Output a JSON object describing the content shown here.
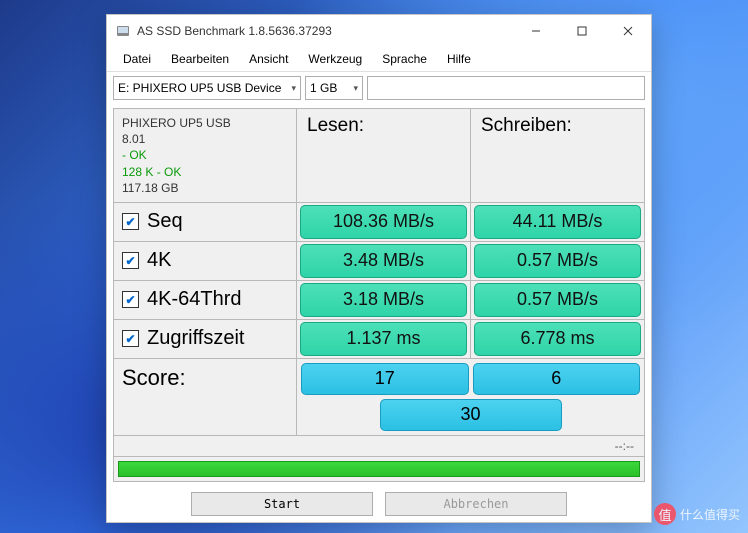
{
  "window": {
    "title": "AS SSD Benchmark 1.8.5636.37293"
  },
  "menu": {
    "datei": "Datei",
    "bearbeiten": "Bearbeiten",
    "ansicht": "Ansicht",
    "werkzeug": "Werkzeug",
    "sprache": "Sprache",
    "hilfe": "Hilfe"
  },
  "toolbar": {
    "drive": "E: PHIXERO UP5 USB Device",
    "size": "1 GB"
  },
  "device": {
    "name": "PHIXERO UP5 USB",
    "fw": "8.01",
    "status1": " - OK",
    "align": "128 K - OK",
    "capacity": "117.18 GB"
  },
  "headers": {
    "read": "Lesen:",
    "write": "Schreiben:"
  },
  "tests": {
    "seq": {
      "label": "Seq",
      "read": "108.36 MB/s",
      "write": "44.11 MB/s"
    },
    "k4": {
      "label": "4K",
      "read": "3.48 MB/s",
      "write": "0.57 MB/s"
    },
    "k4t": {
      "label": "4K-64Thrd",
      "read": "3.18 MB/s",
      "write": "0.57 MB/s"
    },
    "acc": {
      "label": "Zugriffszeit",
      "read": "1.137 ms",
      "write": "6.778 ms"
    }
  },
  "score": {
    "label": "Score:",
    "read": "17",
    "write": "6",
    "total": "30"
  },
  "time": "--:--",
  "buttons": {
    "start": "Start",
    "abort": "Abbrechen"
  },
  "watermark": {
    "icon": "值",
    "text": "什么值得买"
  }
}
